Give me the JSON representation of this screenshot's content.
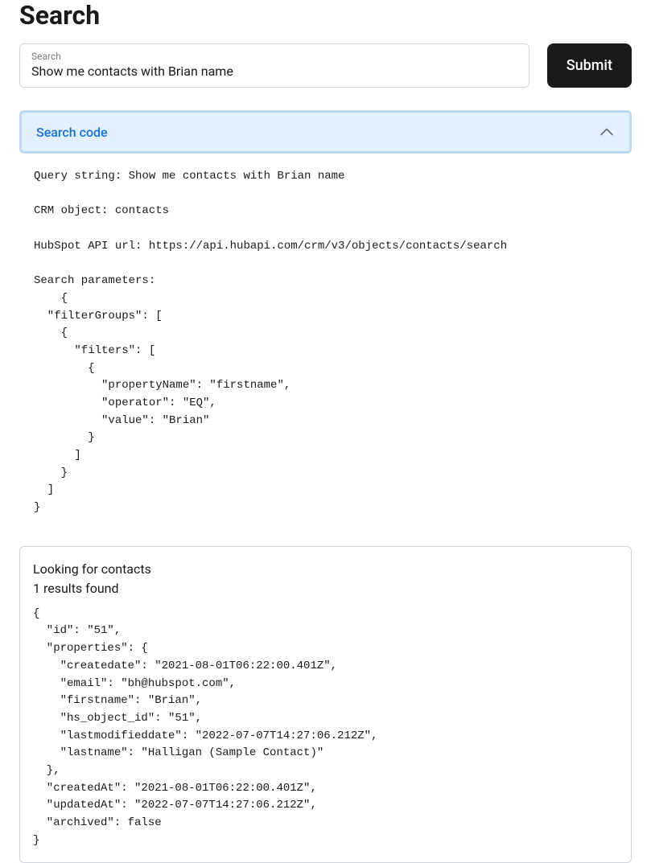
{
  "header": {
    "title": "Search"
  },
  "search": {
    "label": "Search",
    "value": "Show me contacts with Brian name",
    "submit_label": "Submit"
  },
  "accordion": {
    "title": "Search code",
    "expanded": true
  },
  "search_code": "Query string: Show me contacts with Brian name\n\nCRM object: contacts\n\nHubSpot API url: https://api.hubapi.com/crm/v3/objects/contacts/search\n\nSearch parameters:\n    {\n  \"filterGroups\": [\n    {\n      \"filters\": [\n        {\n          \"propertyName\": \"firstname\",\n          \"operator\": \"EQ\",\n          \"value\": \"Brian\"\n        }\n      ]\n    }\n  ]\n}",
  "results": {
    "heading": "Looking for contacts",
    "count_text": "1 results found",
    "json": "{\n  \"id\": \"51\",\n  \"properties\": {\n    \"createdate\": \"2021-08-01T06:22:00.401Z\",\n    \"email\": \"bh@hubspot.com\",\n    \"firstname\": \"Brian\",\n    \"hs_object_id\": \"51\",\n    \"lastmodifieddate\": \"2022-07-07T14:27:06.212Z\",\n    \"lastname\": \"Halligan (Sample Contact)\"\n  },\n  \"createdAt\": \"2021-08-01T06:22:00.401Z\",\n  \"updatedAt\": \"2022-07-07T14:27:06.212Z\",\n  \"archived\": false\n}"
  }
}
